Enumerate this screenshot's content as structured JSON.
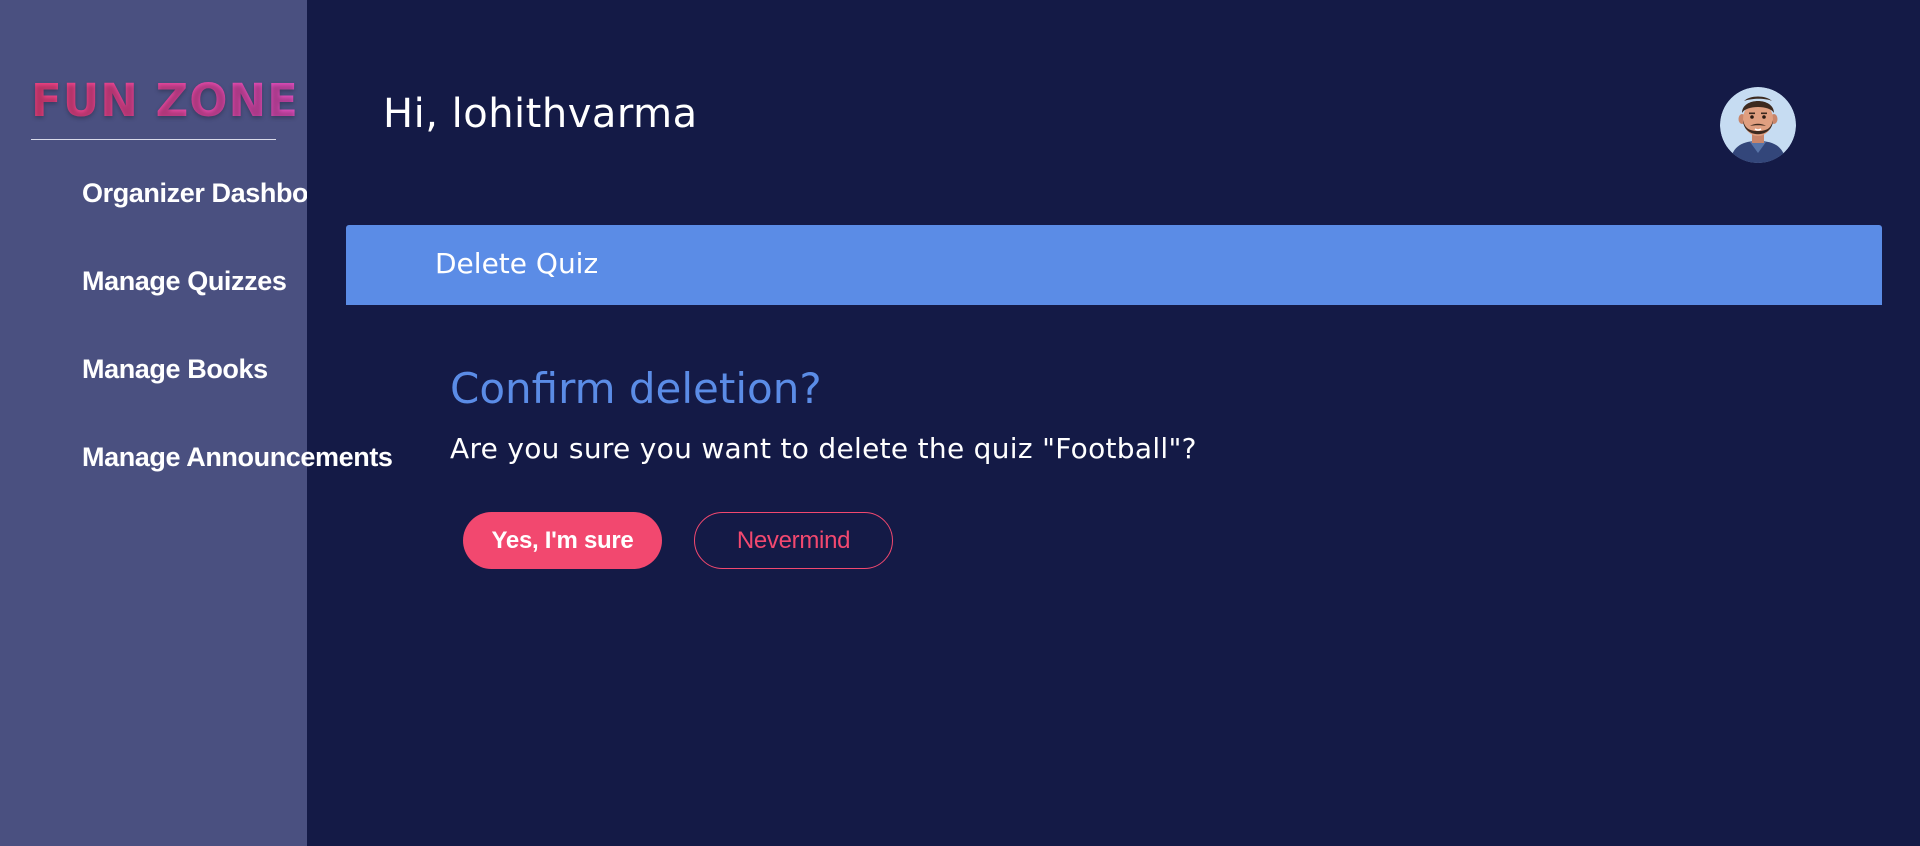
{
  "sidebar": {
    "logo": "FUN ZONE",
    "items": [
      {
        "label": "Organizer Dashboard"
      },
      {
        "label": "Manage Quizzes"
      },
      {
        "label": "Manage Books"
      },
      {
        "label": "Manage Announcements"
      }
    ]
  },
  "header": {
    "greeting": "Hi, lohithvarma",
    "avatar_icon": "bearded-man-avatar-icon"
  },
  "banner": {
    "title": "Delete Quiz"
  },
  "dialog": {
    "title": "Confirm deletion?",
    "message": "Are you sure you want to delete the quiz \"Football\"?",
    "confirm_label": "Yes, I'm sure",
    "cancel_label": "Nevermind"
  },
  "colors": {
    "background": "#141a46",
    "sidebar": "#4a5080",
    "accent_blue": "#5b8ce6",
    "accent_pink": "#f2486f",
    "logo_gradient_start": "#f24383",
    "logo_gradient_end": "#e04fc0"
  }
}
